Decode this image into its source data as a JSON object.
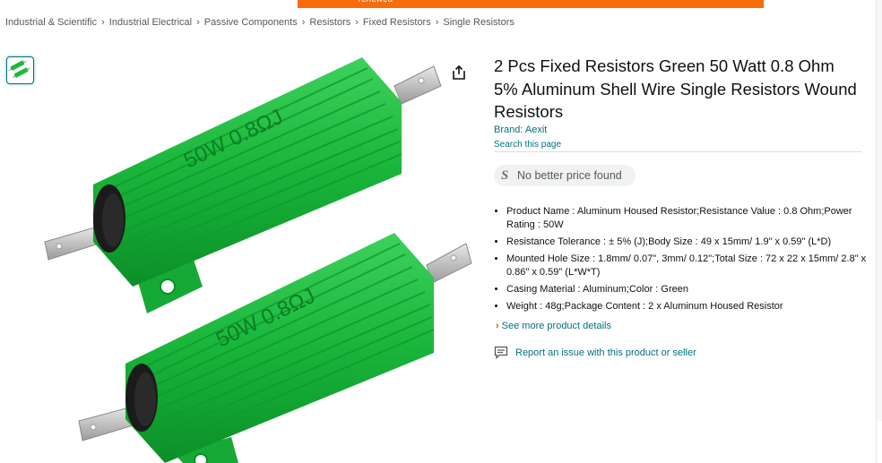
{
  "promo": {
    "text": "renewed"
  },
  "breadcrumb": [
    "Industrial & Scientific",
    "Industrial Electrical",
    "Passive Components",
    "Resistors",
    "Fixed Resistors",
    "Single Resistors"
  ],
  "breadcrumb_separator": "›",
  "product": {
    "title": "2 Pcs Fixed Resistors Green 50 Watt 0.8 Ohm 5% Aluminum Shell Wire Single Resistors Wound Resistors",
    "brand": "Brand: Aexit",
    "search_page": "Search this page",
    "price_status": "No better price found",
    "resistor_marking": "50W 0.8ΩJ",
    "bullets": [
      "Product Name : Aluminum Housed Resistor;Resistance Value : 0.8 Ohm;Power Rating : 50W",
      "Resistance Tolerance : ± 5% (J);Body Size : 49 x 15mm/ 1.9\" x 0.59\" (L*D)",
      "Mounted Hole Size : 1.8mm/ 0.07\", 3mm/ 0.12\";Total Size : 72 x 22 x 15mm/ 2.8\" x 0.86\" x 0.59\" (L*W*T)",
      "Casing Material : Aluminum;Color : Green",
      "Weight : 48g;Package Content : 2 x Aluminum Housed Resistor"
    ],
    "see_more": "See more product details",
    "report": "Report an issue with this product or seller"
  },
  "colors": {
    "link": "#007185",
    "promo": "#f86c0a",
    "resistor_green": "#1fb83f",
    "chevron": "#c45500"
  },
  "icons": {
    "share": "share-icon",
    "price": "s-price-icon",
    "report": "report-chat-icon"
  }
}
